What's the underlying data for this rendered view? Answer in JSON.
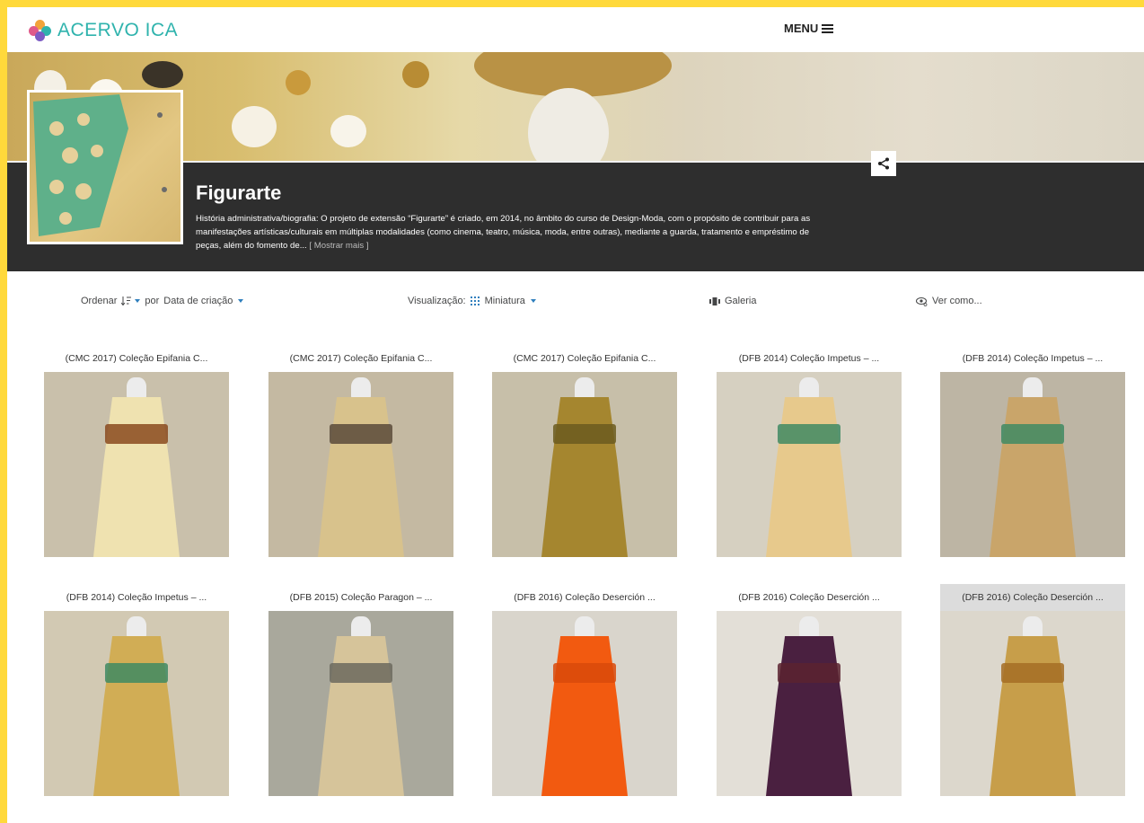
{
  "header": {
    "logo_text": "ACERVO ICA",
    "menu_label": "MENU"
  },
  "collection": {
    "title": "Figurarte",
    "description": "História administrativa/biografia: O projeto de extensão “Figurarte” é criado, em 2014, no âmbito do curso de Design-Moda, com o propósito de contribuir para as manifestações artísticas/culturais em múltiplas modalidades (como cinema, teatro, música, moda, entre outras), mediante a guarda, tratamento e empréstimo de peças, além do fomento de...",
    "show_more": "[ Mostrar mais ]"
  },
  "toolbar": {
    "order_label": "Ordenar",
    "by_label": "por",
    "sort_value": "Data de criação",
    "view_label": "Visualização:",
    "view_value": "Miniatura",
    "gallery_label": "Galeria",
    "view_as_label": "Ver como..."
  },
  "items": [
    {
      "caption": "(CMC 2017) Coleção Epifania C...",
      "bg": "#c9c0ab",
      "garment": "#efe2b0",
      "accent": "#8a4a1f"
    },
    {
      "caption": "(CMC 2017) Coleção Epifania C...",
      "bg": "#c4b9a2",
      "garment": "#d8c28c",
      "accent": "#5a4a3a"
    },
    {
      "caption": "(CMC 2017) Coleção Epifania C...",
      "bg": "#c7bfa9",
      "garment": "#a5862f",
      "accent": "#6b5a1e"
    },
    {
      "caption": "(DFB 2014) Coleção Impetus – ...",
      "bg": "#d6d0c1",
      "garment": "#e7c98c",
      "accent": "#3f8a63"
    },
    {
      "caption": "(DFB 2014) Coleção Impetus – ...",
      "bg": "#bdb5a4",
      "garment": "#c9a56a",
      "accent": "#3f8a63"
    },
    {
      "caption": "(DFB 2014) Coleção Impetus – ...",
      "bg": "#d2c9b3",
      "garment": "#d1ad55",
      "accent": "#3f8a63"
    },
    {
      "caption": "(DFB 2015) Coleção Paragon – ...",
      "bg": "#a9a89c",
      "garment": "#d6c49a",
      "accent": "#6c6a5e"
    },
    {
      "caption": "(DFB 2016) Coleção Deserción ...",
      "bg": "#d9d5cc",
      "garment": "#f25a10",
      "accent": "#d94a0a"
    },
    {
      "caption": "(DFB 2016) Coleção Deserción ...",
      "bg": "#e3dfd7",
      "garment": "#4a2040",
      "accent": "#5a2330"
    },
    {
      "caption": "(DFB 2016) Coleção Deserción ...",
      "bg": "#dcd7cc",
      "garment": "#c79e4a",
      "accent": "#a56d25"
    }
  ]
}
